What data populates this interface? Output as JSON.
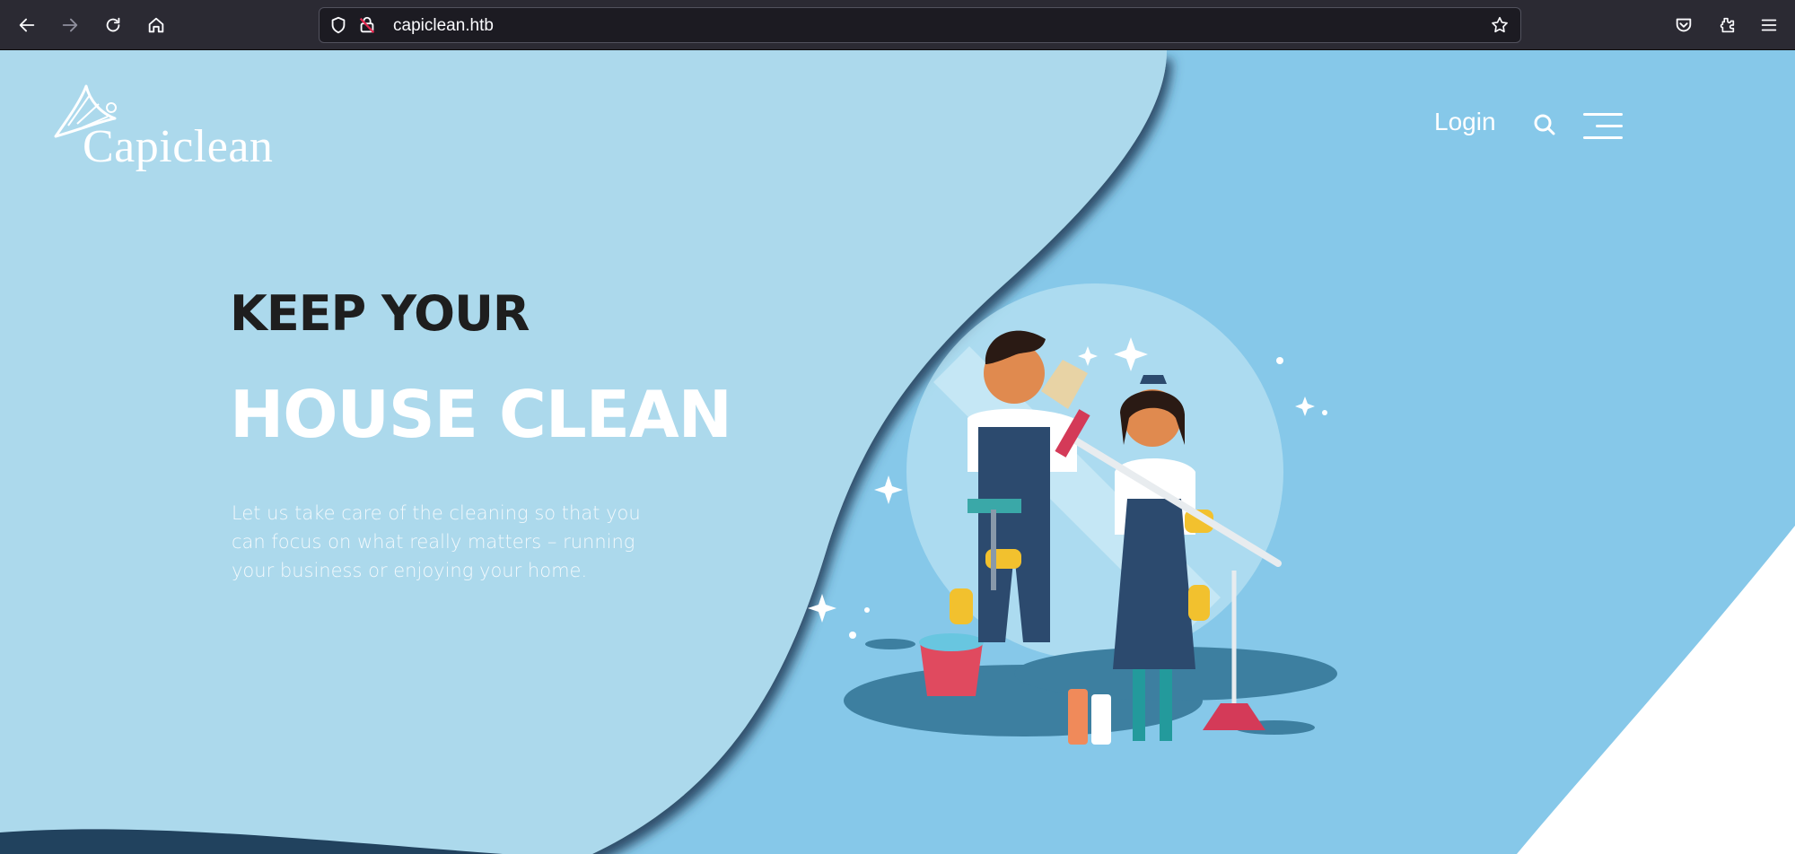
{
  "browser": {
    "url": "capiclean.htb",
    "icons": [
      "back-arrow-icon",
      "forward-arrow-icon",
      "reload-icon",
      "home-icon",
      "shield-icon",
      "insecure-lock-icon",
      "bookmark-star-icon",
      "pocket-icon",
      "extensions-icon",
      "app-menu-icon"
    ]
  },
  "site": {
    "logo_text": "Capiclean",
    "nav": {
      "login": "Login"
    },
    "hero": {
      "line1": "KEEP YOUR",
      "line2": "HOUSE CLEAN",
      "description": "Let us take care of the cleaning so that you can focus on what really matters – running your business or enjoying your home."
    }
  },
  "colors": {
    "left_panel": "#acd9ec",
    "right_panel": "#86c8e9",
    "heading_dark": "#1e1e1e",
    "heading_light": "#ffffff",
    "browser_toolbar": "#2b2a33"
  }
}
